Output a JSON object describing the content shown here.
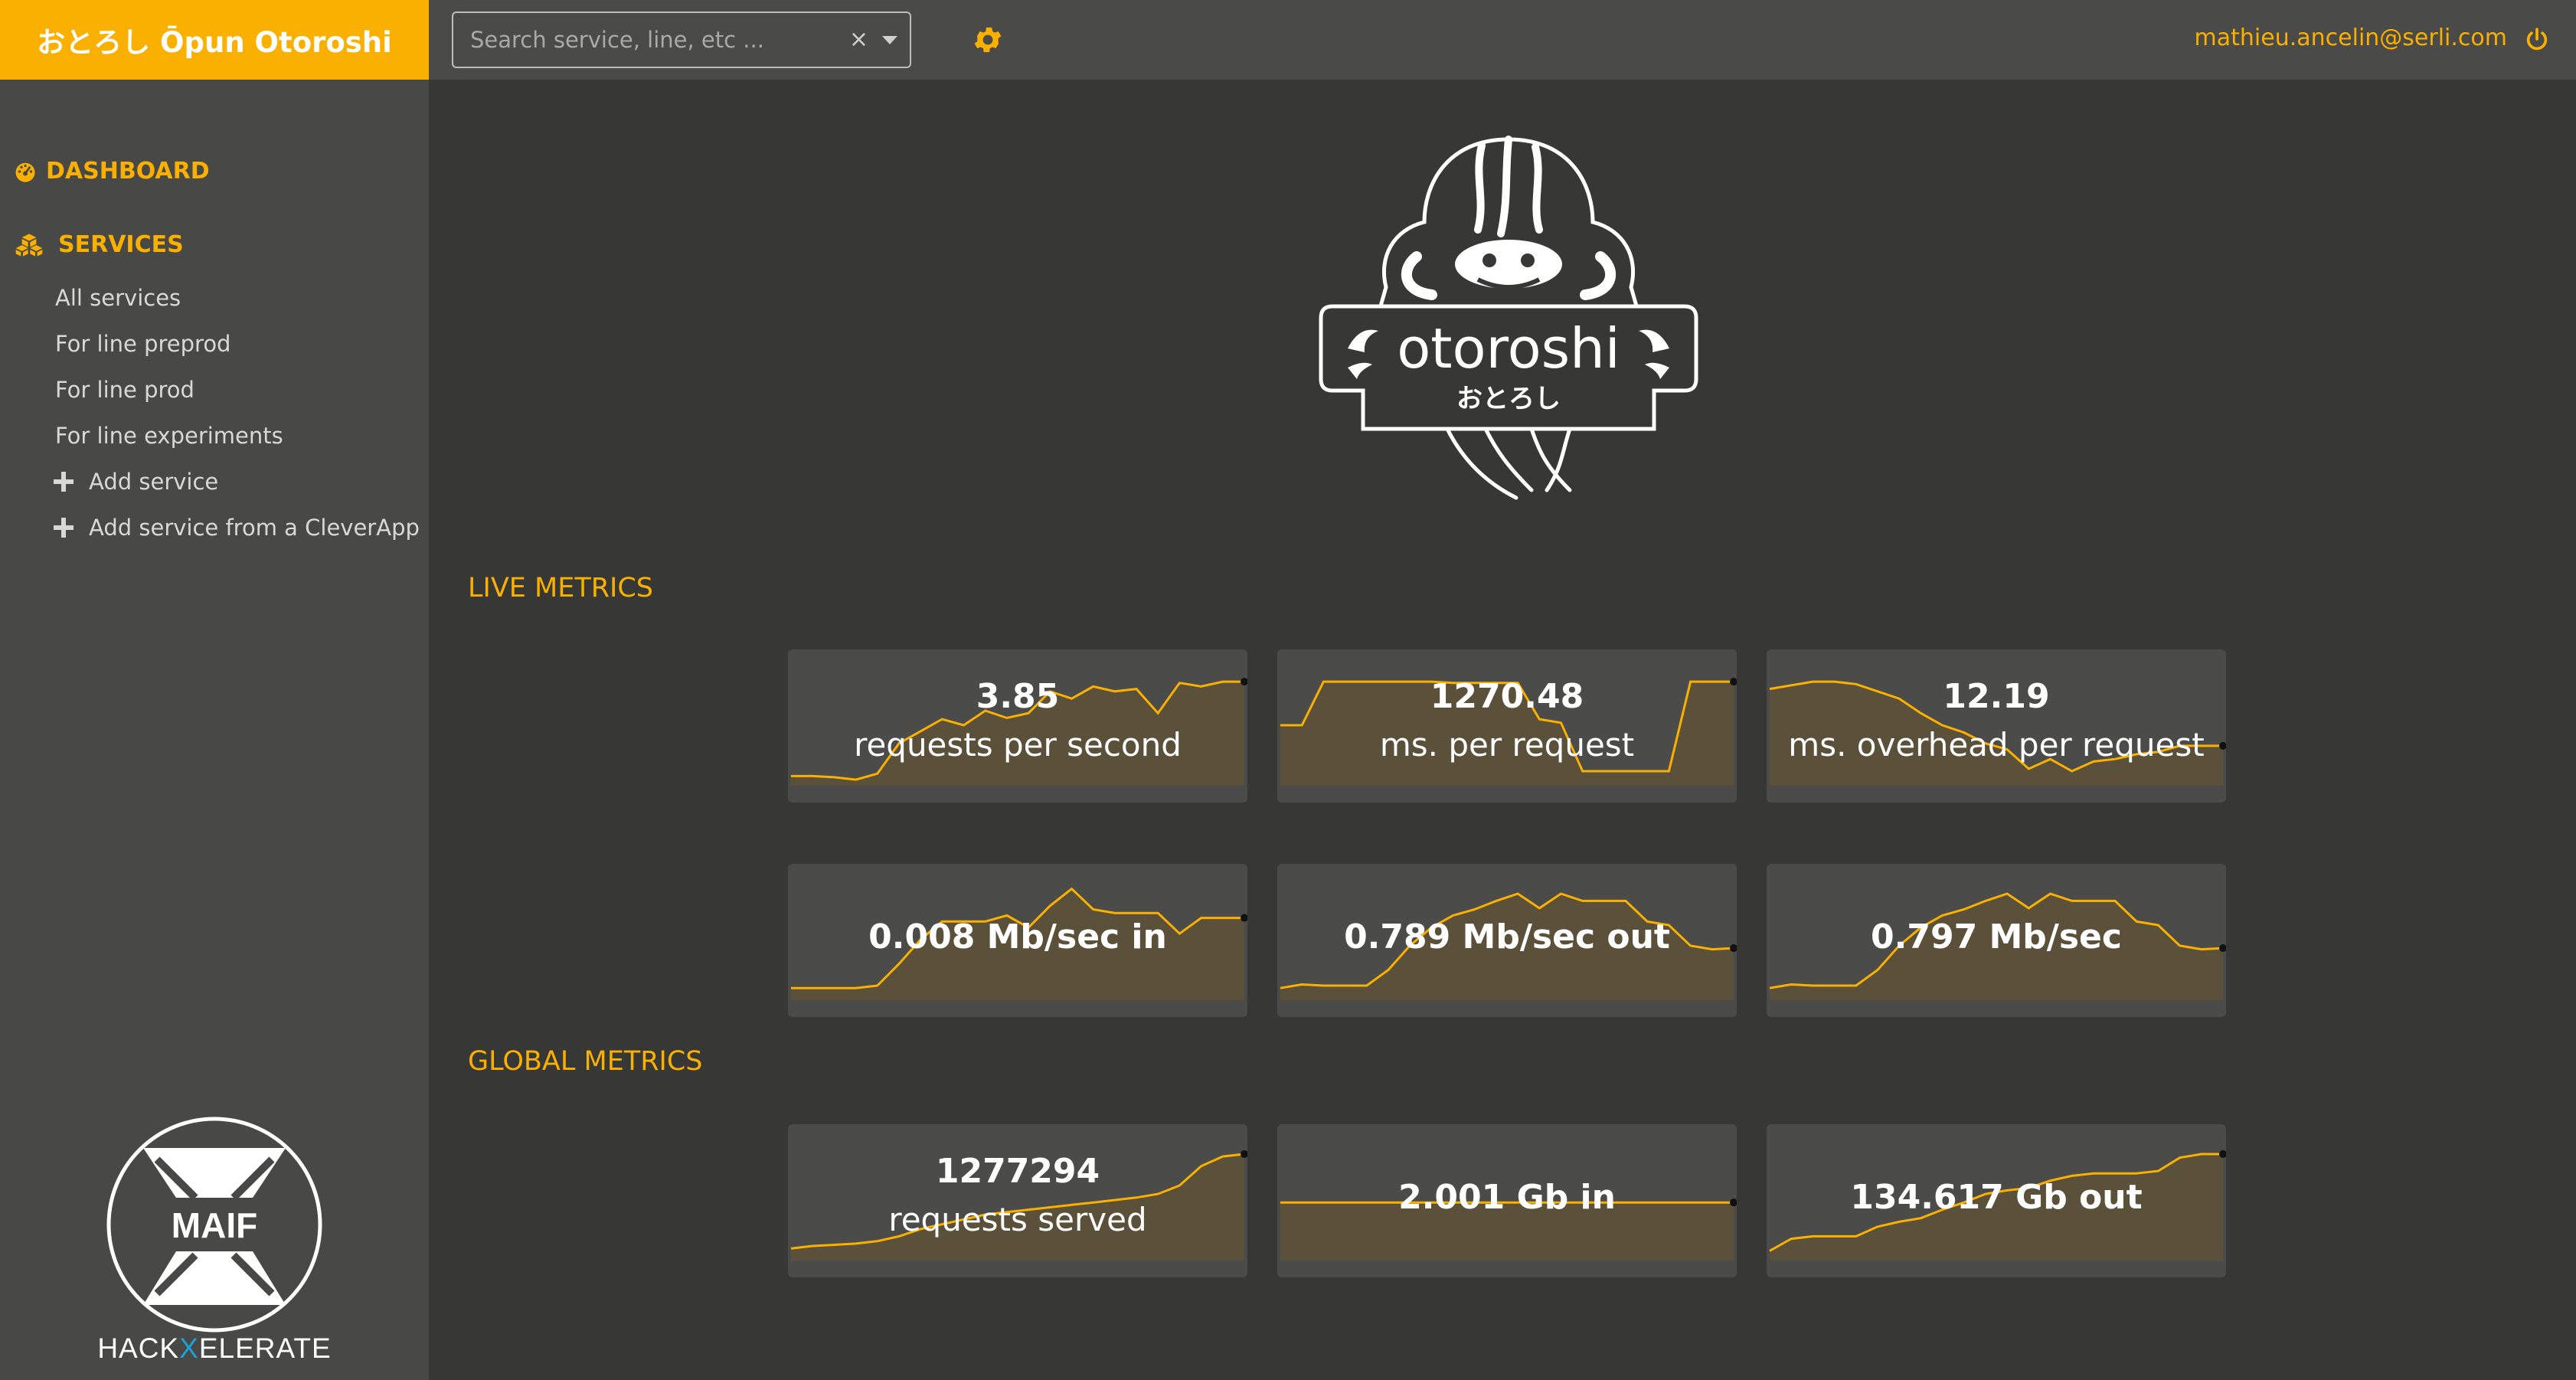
{
  "header": {
    "brand": "おとろし Ōpun Otoroshi",
    "search_placeholder": "Search service, line, etc ...",
    "search_clear": "×",
    "settings_icon": "gear-icon",
    "user_email": "mathieu.ancelin@serli.com",
    "logout_icon": "power-icon"
  },
  "sidebar": {
    "dashboard_label": "DASHBOARD",
    "services_label": "SERVICES",
    "items": [
      {
        "label": "All services"
      },
      {
        "label": "For line preprod"
      },
      {
        "label": "For line prod"
      },
      {
        "label": "For line experiments"
      }
    ],
    "actions": [
      {
        "label": "Add service"
      },
      {
        "label": "Add service from a CleverApp"
      }
    ],
    "sponsor": {
      "logo_text": "MAIF",
      "text_pre": "HACK",
      "text_x": "X",
      "text_post": "ELERATE"
    }
  },
  "logo": {
    "wordmark": "otoroshi",
    "kana": "おとろし"
  },
  "colors": {
    "accent": "#f9b000",
    "background": "#373735",
    "panel": "#4b4b49"
  },
  "live_metrics": {
    "title": "LIVE METRICS",
    "cards": [
      {
        "value": "3.85",
        "label": "requests per second",
        "series": [
          0.08,
          0.08,
          0.07,
          0.05,
          0.1,
          0.35,
          0.45,
          0.55,
          0.5,
          0.62,
          0.56,
          0.6,
          0.78,
          0.72,
          0.82,
          0.78,
          0.8,
          0.6,
          0.85,
          0.82,
          0.86,
          0.86
        ]
      },
      {
        "value": "1270.48",
        "label": "ms. per request",
        "series": [
          0.5,
          0.5,
          0.86,
          0.86,
          0.86,
          0.86,
          0.86,
          0.86,
          0.85,
          0.85,
          0.85,
          0.85,
          0.55,
          0.52,
          0.12,
          0.12,
          0.12,
          0.12,
          0.12,
          0.86,
          0.86,
          0.86
        ]
      },
      {
        "value": "12.19",
        "label": "ms. overhead per request",
        "series": [
          0.8,
          0.83,
          0.86,
          0.86,
          0.84,
          0.78,
          0.72,
          0.6,
          0.5,
          0.44,
          0.35,
          0.3,
          0.14,
          0.22,
          0.12,
          0.2,
          0.22,
          0.26,
          0.28,
          0.33,
          0.33,
          0.33
        ]
      }
    ]
  },
  "throughput": {
    "cards": [
      {
        "value": "0.008 Mb/sec in",
        "series": [
          0.1,
          0.1,
          0.1,
          0.1,
          0.12,
          0.3,
          0.5,
          0.65,
          0.65,
          0.65,
          0.7,
          0.6,
          0.78,
          0.92,
          0.75,
          0.72,
          0.72,
          0.72,
          0.55,
          0.68,
          0.68,
          0.68
        ]
      },
      {
        "value": "0.789 Mb/sec out",
        "series": [
          0.1,
          0.13,
          0.12,
          0.12,
          0.12,
          0.25,
          0.45,
          0.6,
          0.7,
          0.75,
          0.82,
          0.88,
          0.76,
          0.88,
          0.82,
          0.82,
          0.82,
          0.65,
          0.62,
          0.45,
          0.42,
          0.43
        ]
      },
      {
        "value": "0.797 Mb/sec",
        "series": [
          0.1,
          0.13,
          0.12,
          0.12,
          0.12,
          0.25,
          0.45,
          0.6,
          0.7,
          0.75,
          0.82,
          0.88,
          0.76,
          0.88,
          0.82,
          0.82,
          0.82,
          0.65,
          0.62,
          0.45,
          0.42,
          0.43
        ]
      }
    ]
  },
  "global_metrics": {
    "title": "GLOBAL METRICS",
    "cards": [
      {
        "value": "1277294",
        "label": "requests served",
        "series": [
          0.1,
          0.12,
          0.13,
          0.14,
          0.16,
          0.2,
          0.26,
          0.3,
          0.34,
          0.38,
          0.4,
          0.42,
          0.44,
          0.46,
          0.48,
          0.5,
          0.52,
          0.55,
          0.62,
          0.78,
          0.86,
          0.88
        ]
      },
      {
        "value": "2.001 Gb in",
        "series": [
          0.48,
          0.48,
          0.48,
          0.48,
          0.48,
          0.48,
          0.48,
          0.48,
          0.48,
          0.48,
          0.48,
          0.48,
          0.48,
          0.48,
          0.48,
          0.48,
          0.48,
          0.48,
          0.48,
          0.48,
          0.48,
          0.48
        ]
      },
      {
        "value": "134.617 Gb out",
        "series": [
          0.08,
          0.18,
          0.2,
          0.2,
          0.2,
          0.28,
          0.32,
          0.35,
          0.42,
          0.48,
          0.55,
          0.58,
          0.6,
          0.66,
          0.7,
          0.72,
          0.72,
          0.72,
          0.74,
          0.85,
          0.88,
          0.88
        ]
      }
    ]
  }
}
